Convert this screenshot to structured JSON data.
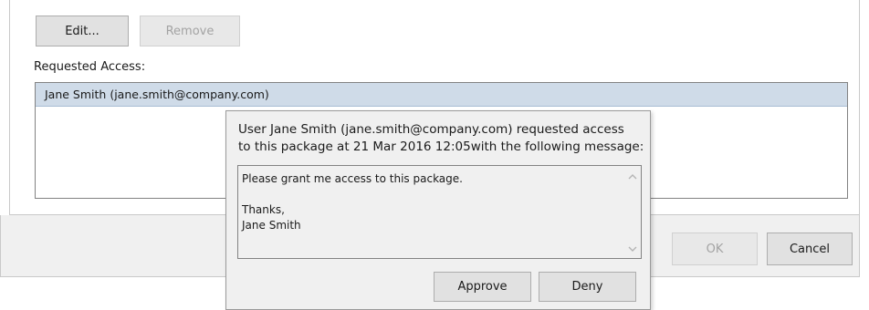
{
  "toolbar": {
    "edit_label": "Edit...",
    "remove_label": "Remove"
  },
  "requested_access": {
    "label": "Requested Access:",
    "items": [
      {
        "label": "Jane Smith (jane.smith@company.com)"
      }
    ]
  },
  "popup": {
    "message_lines": [
      "User Jane Smith (jane.smith@company.com) requested access",
      "to this package at 21 Mar 2016 12:05with the following message:"
    ],
    "request_message_lines": [
      "Please grant me access to this package.",
      "",
      "Thanks,",
      "Jane Smith"
    ],
    "approve_label": "Approve",
    "deny_label": "Deny",
    "scroll_up_icon": "chevron-up-icon",
    "scroll_down_icon": "chevron-down-icon"
  },
  "footer": {
    "ok_label": "OK",
    "cancel_label": "Cancel"
  },
  "colors": {
    "selection": "#cfdbe8",
    "button_face": "#e1e1e1",
    "dialog_bg": "#f0f0f0",
    "disabled_text": "#a3a3a3"
  }
}
